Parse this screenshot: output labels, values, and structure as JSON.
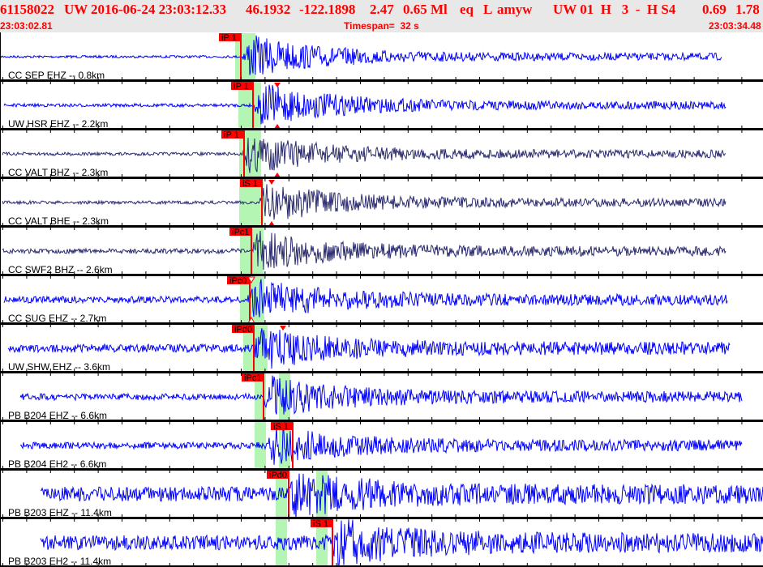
{
  "header": {
    "event_id": "61158022",
    "network": "UW",
    "datetime": "2016-06-24 23:03:12.33",
    "lat": "46.1932",
    "lon": "-122.1898",
    "depth": "2.47",
    "magnitude": "0.65 Ml",
    "etype": "eq",
    "gtype": "L",
    "author": "amyw",
    "solution": "UW 01  H   3  -  H S4",
    "rms": "0.69",
    "err": "1.78",
    "start_time": "23:03:02.81",
    "timespan": "Timespan=  32 s",
    "end_time": "23:03:34.48"
  },
  "colors": {
    "header_bg": "#e8e8e8",
    "header_text": "#ff0000",
    "trace_blue": "#0000ff",
    "trace_navy": "#2a2a70",
    "pick": "#ff0000",
    "window": "#b4f5b4"
  },
  "channels": [
    {
      "label": "CC SEP EHZ -- 0.8km",
      "pick": "iP 1"
    },
    {
      "label": "UW HSR EHZ -- 2.2km",
      "pick": "iP 1"
    },
    {
      "label": "CC VALT BHZ -- 2.3km",
      "pick": "iP 1"
    },
    {
      "label": "CC VALT BHE -- 2.3km",
      "pick": "iS 1"
    },
    {
      "label": "CC SWF2 BHZ -- 2.6km",
      "pick": "iPc1"
    },
    {
      "label": "CC SUG EHZ -- 2.7km",
      "pick": "iPc0"
    },
    {
      "label": "UW SHW EHZ -- 3.6km",
      "pick": "iPd0"
    },
    {
      "label": "PB B204 EHZ -- 6.6km",
      "pick": "iPc1"
    },
    {
      "label": "PB B204 EH2 -- 6.6km",
      "pick": "iS 1"
    },
    {
      "label": "PB B203 EHZ -- 11.4km",
      "pick": "iPd0"
    },
    {
      "label": "PB B203 EH2 -- 11.4km",
      "pick": "iS 1"
    }
  ]
}
